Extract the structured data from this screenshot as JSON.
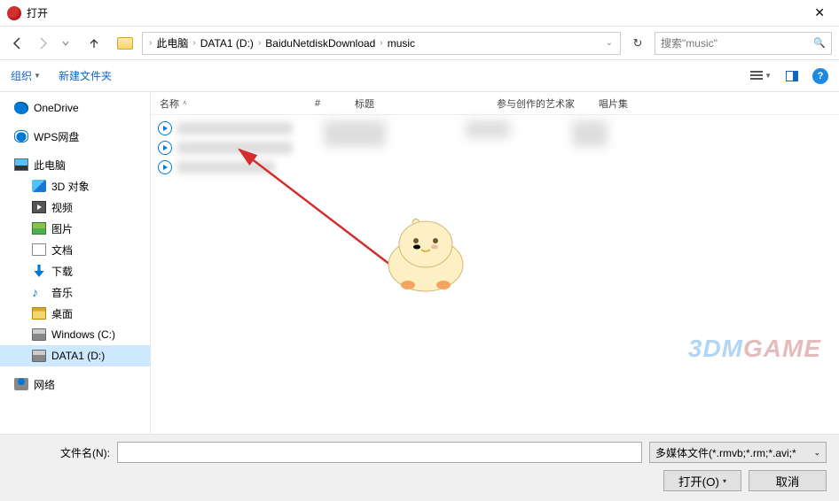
{
  "title": "打开",
  "breadcrumb": {
    "pc": "此电脑",
    "drive": "DATA1 (D:)",
    "folder1": "BaiduNetdiskDownload",
    "folder2": "music"
  },
  "search": {
    "placeholder": "搜索\"music\""
  },
  "toolbar": {
    "organize": "组织",
    "newfolder": "新建文件夹"
  },
  "sidebar": {
    "onedrive": "OneDrive",
    "wps": "WPS网盘",
    "pc": "此电脑",
    "objects3d": "3D 对象",
    "video": "视频",
    "image": "图片",
    "doc": "文档",
    "download": "下载",
    "music": "音乐",
    "desktop": "桌面",
    "windowsc": "Windows (C:)",
    "data1d": "DATA1 (D:)",
    "network": "网络"
  },
  "columns": {
    "name": "名称",
    "num": "#",
    "title": "标题",
    "artist": "参与创作的艺术家",
    "album": "唱片集"
  },
  "bottom": {
    "filename_label": "文件名(N):",
    "filetype": "多媒体文件(*.rmvb;*.rm;*.avi;*",
    "open": "打开(O)",
    "cancel": "取消"
  },
  "watermark": {
    "a": "3DM",
    "b": "GAME"
  }
}
